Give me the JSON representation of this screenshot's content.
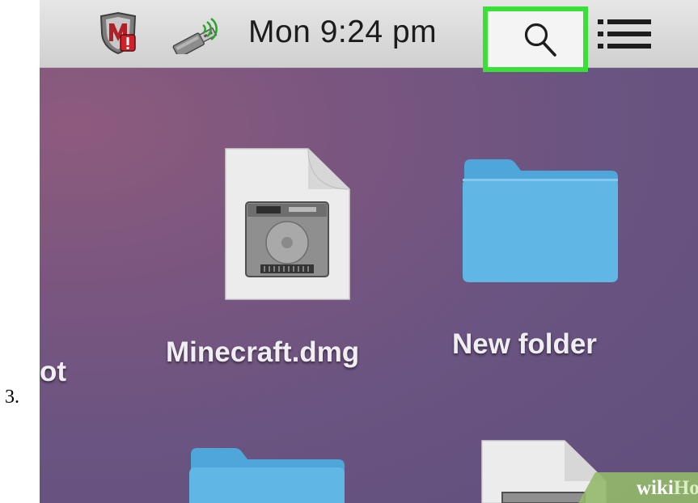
{
  "step": {
    "number": "3."
  },
  "menubar": {
    "clock": "Mon 9:24 pm",
    "icons": [
      "security-shield-icon",
      "usb-drive-icon",
      "spotlight-search-icon",
      "notification-center-icon"
    ],
    "highlight_color": "#39e037"
  },
  "desktop": {
    "items": [
      {
        "label": "Minecraft.dmg",
        "icon": "disk-image-icon"
      },
      {
        "label": "New folder",
        "icon": "folder-icon"
      },
      {
        "label": "ot",
        "icon": "partial-file-icon"
      }
    ],
    "folder_color": "#56b0e0"
  },
  "watermark": {
    "wiki": "wiki",
    "how": "How"
  }
}
